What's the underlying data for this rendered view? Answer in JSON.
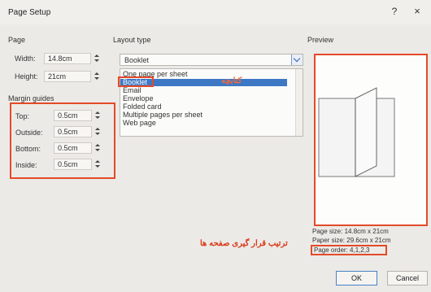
{
  "window": {
    "title": "Page Setup",
    "help": "?",
    "close": "×"
  },
  "page": {
    "section_label": "Page",
    "width_label": "Width:",
    "width_value": "14.8cm",
    "height_label": "Height:",
    "height_value": "21cm"
  },
  "margins": {
    "section_label": "Margin guides",
    "fields": [
      {
        "label": "Top:",
        "value": "0.5cm"
      },
      {
        "label": "Outside:",
        "value": "0.5cm"
      },
      {
        "label": "Bottom:",
        "value": "0.5cm"
      },
      {
        "label": "Inside:",
        "value": "0.5cm"
      }
    ]
  },
  "layout": {
    "section_label": "Layout type",
    "selected": "Booklet",
    "options": [
      "One page per sheet",
      "Booklet",
      "Email",
      "Envelope",
      "Folded card",
      "Multiple pages per sheet",
      "Web page"
    ],
    "annotation": "کتابچه"
  },
  "preview": {
    "section_label": "Preview",
    "page_size": "Page size: 14.8cm x 21cm",
    "paper_size": "Paper size: 29.6cm x 21cm",
    "page_order": "Page order: 4,1,2,3",
    "annotation": "ترتیب قرار گیری صفحه ها"
  },
  "buttons": {
    "ok": "OK",
    "cancel": "Cancel"
  },
  "colors": {
    "highlight": "#e44a2a",
    "selection": "#3d78c4",
    "dialog_bg": "#eceae6"
  }
}
